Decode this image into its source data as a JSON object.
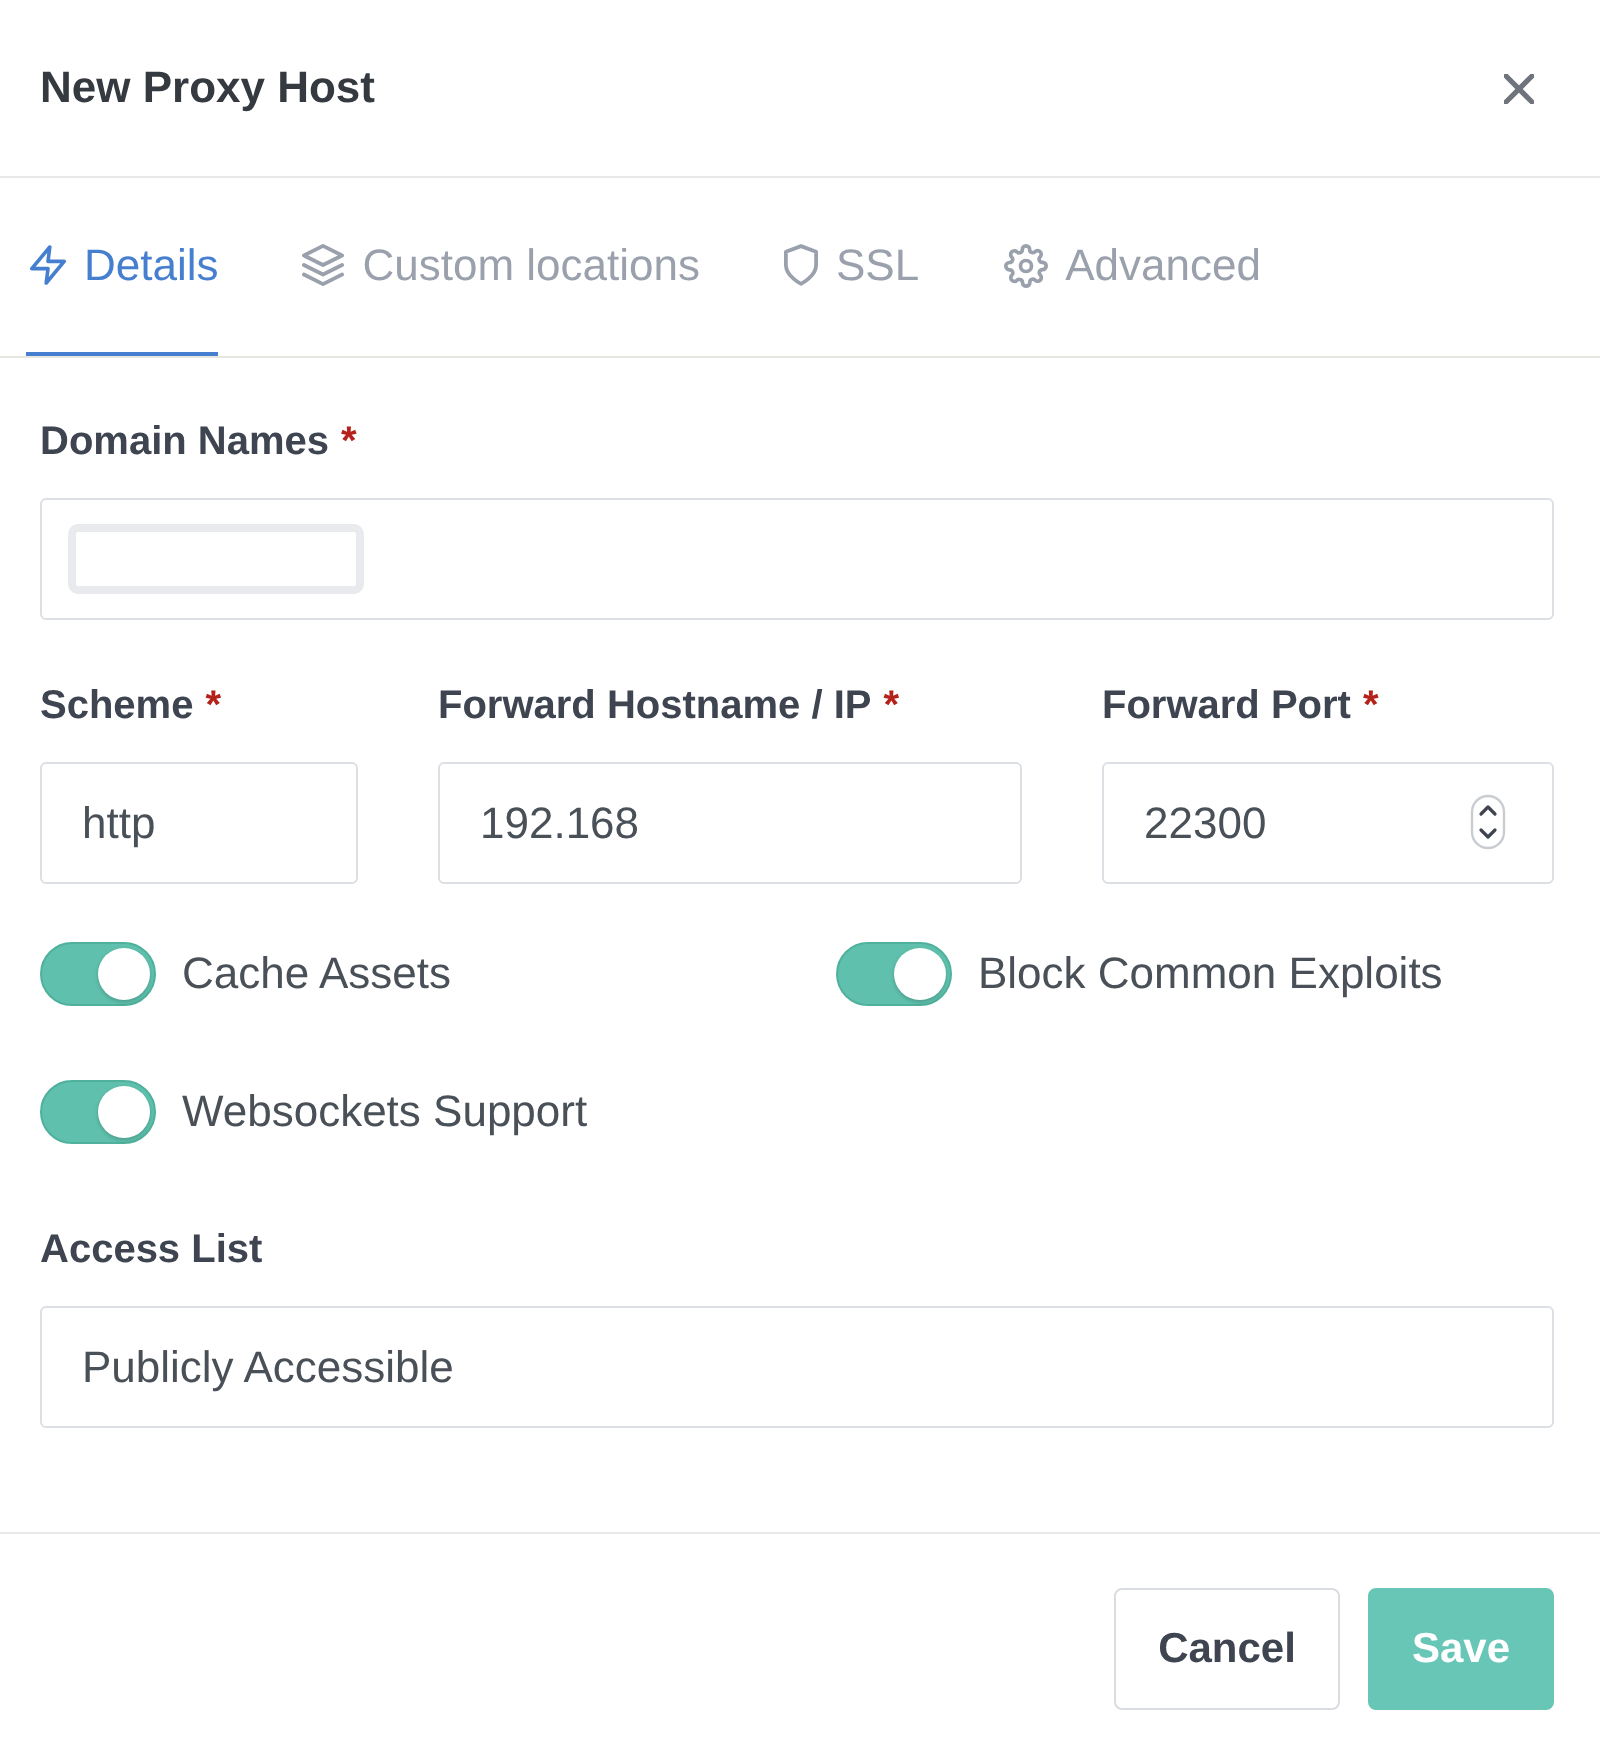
{
  "dialog": {
    "title": "New Proxy Host"
  },
  "tabs": [
    {
      "label": "Details",
      "selected": true
    },
    {
      "label": "Custom locations",
      "selected": false
    },
    {
      "label": "SSL",
      "selected": false
    },
    {
      "label": "Advanced",
      "selected": false
    }
  ],
  "domain_names": {
    "label": "Domain Names",
    "required_mark": "*",
    "blank_tag": true
  },
  "target_fields": [
    {
      "kind": "text",
      "label": "Scheme",
      "required_mark": "*",
      "value": "http"
    },
    {
      "kind": "text",
      "label": "Forward Hostname / IP",
      "required_mark": "*",
      "value": "192.168"
    },
    {
      "kind": "number",
      "label": "Forward Port",
      "required_mark": "*",
      "value": "22300"
    }
  ],
  "options": [
    {
      "label": "Cache Assets",
      "on": true
    },
    {
      "label": "Block Common Exploits",
      "on": true
    },
    {
      "label": "Websockets Support",
      "on": true
    }
  ],
  "access_list": {
    "label": "Access List",
    "value": "Publicly Accessible"
  },
  "buttons": [
    {
      "kind": "secondary",
      "label": "Cancel"
    },
    {
      "kind": "primary",
      "label": "Save"
    }
  ]
}
